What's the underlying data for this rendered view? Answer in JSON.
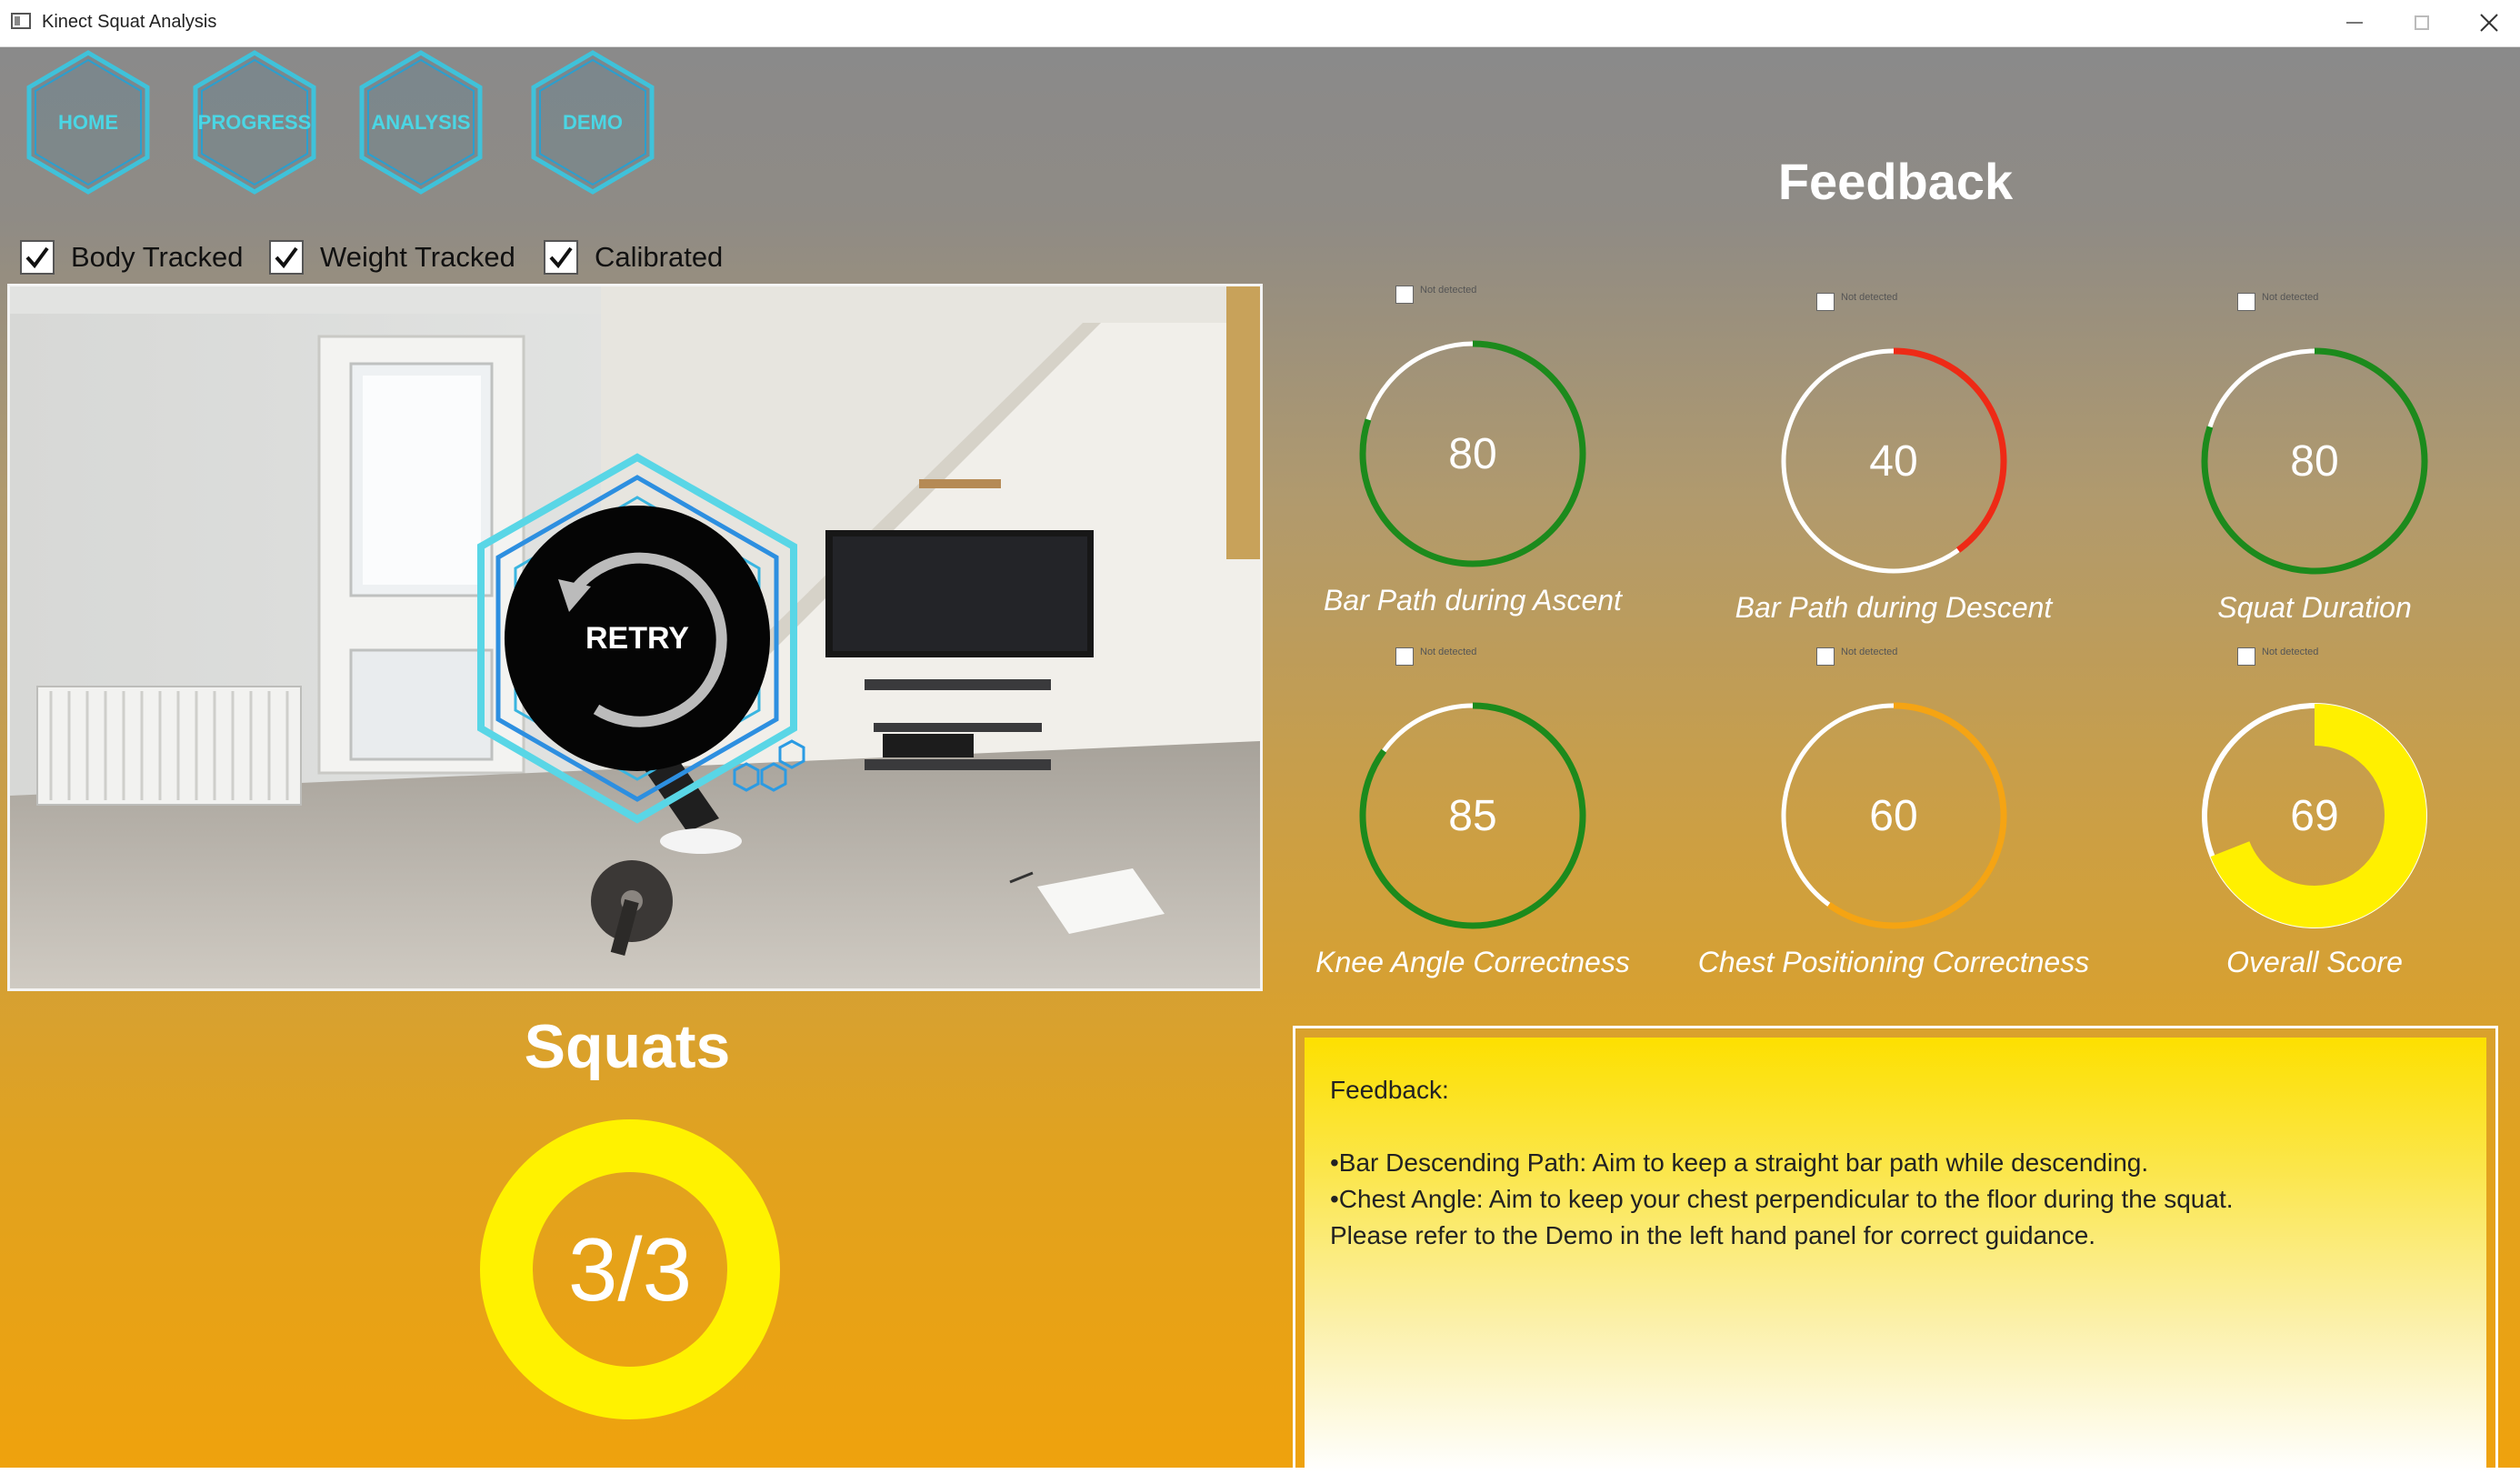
{
  "window": {
    "title": "Kinect Squat Analysis"
  },
  "nav": [
    {
      "label": "HOME"
    },
    {
      "label": "PROGRESS"
    },
    {
      "label": "ANALYSIS"
    },
    {
      "label": "DEMO"
    }
  ],
  "status": [
    {
      "label": "Body Tracked",
      "checked": true
    },
    {
      "label": "Weight Tracked",
      "checked": true
    },
    {
      "label": "Calibrated",
      "checked": true
    }
  ],
  "camera": {
    "retry_label": "RETRY"
  },
  "squats": {
    "title": "Squats",
    "count": "3/3",
    "completed": 3,
    "total": 3,
    "ring_color": "#fff200"
  },
  "feedback": {
    "title": "Feedback",
    "not_detected_label": "Not detected",
    "metrics": [
      {
        "label": "Bar Path during Ascent",
        "value": "80",
        "score": 80,
        "color": "#1c8a1c"
      },
      {
        "label": "Bar Path during Descent",
        "value": "40",
        "score": 40,
        "color": "#ee2a16"
      },
      {
        "label": "Squat Duration",
        "value": "80",
        "score": 80,
        "color": "#1c8a1c"
      },
      {
        "label": "Knee Angle Correctness",
        "value": "85",
        "score": 85,
        "color": "#1c8a1c"
      },
      {
        "label": "Chest Positioning Correctness",
        "value": "60",
        "score": 60,
        "color": "#f5a413"
      },
      {
        "label": "Overall Score",
        "value": "69",
        "score": 69,
        "color": "#fff000",
        "thick": true
      }
    ],
    "box": {
      "heading": "Feedback:",
      "lines": [
        "•Bar Descending Path: Aim to keep a straight bar path while descending.",
        "•Chest Angle: Aim to keep your chest perpendicular to the floor during the squat.",
        "Please refer to the Demo in the left hand panel for correct guidance."
      ]
    }
  },
  "colors": {
    "nav_accent": "#4ad6e4",
    "window_close": "#333333"
  }
}
